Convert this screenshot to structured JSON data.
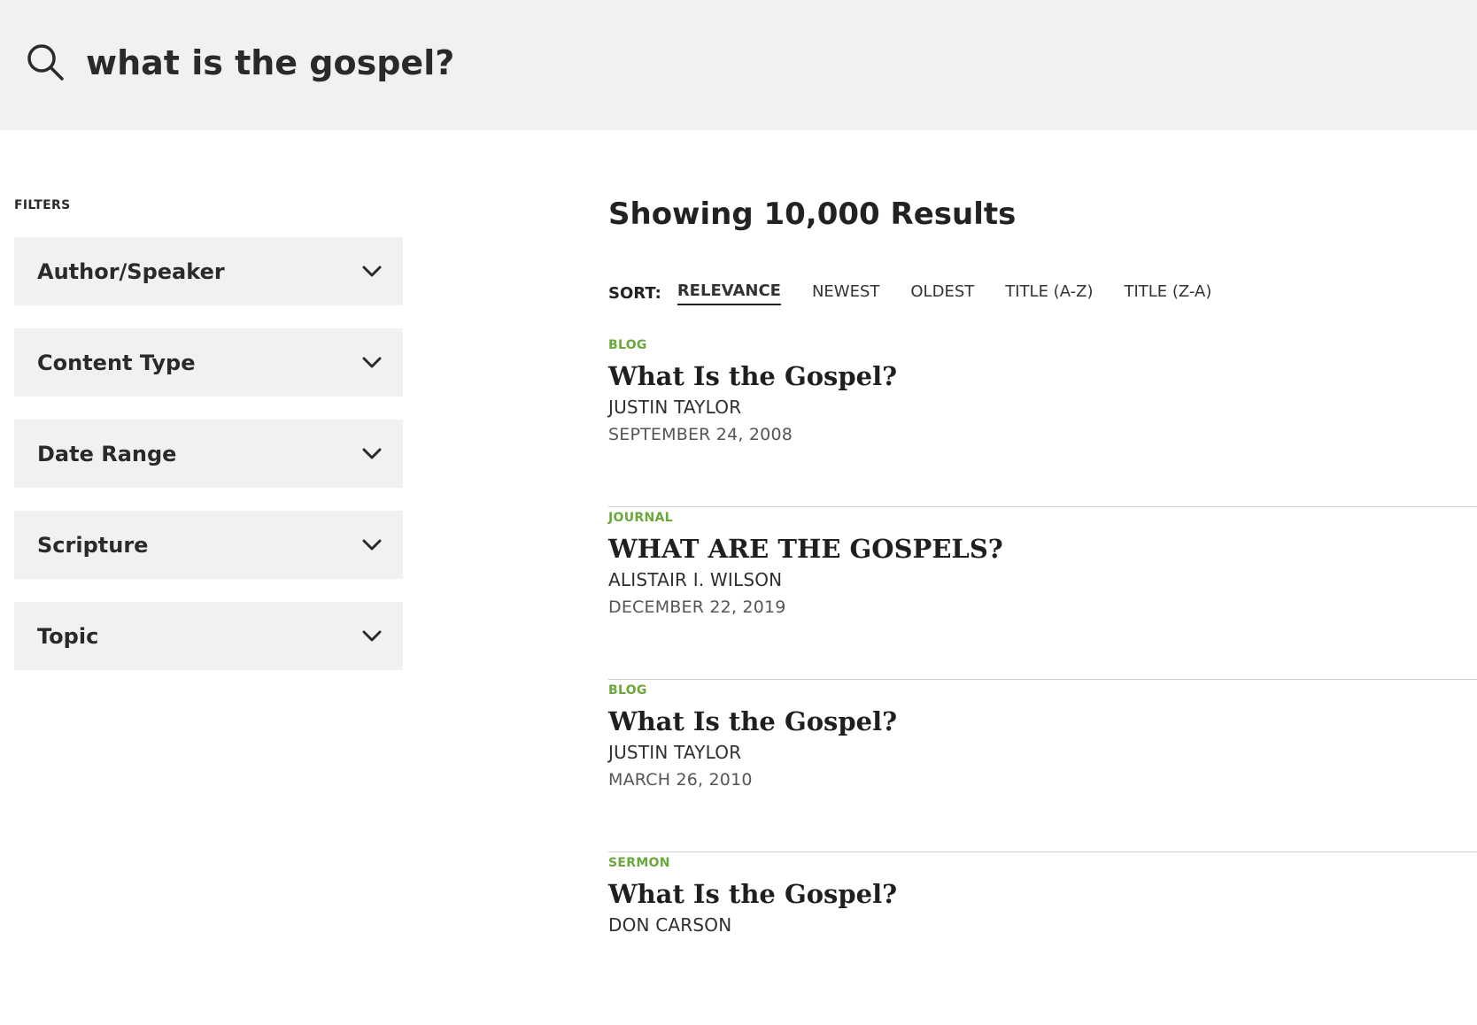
{
  "search": {
    "query": "what is the gospel?"
  },
  "filters": {
    "heading": "FILTERS",
    "items": [
      {
        "label": "Author/Speaker"
      },
      {
        "label": "Content Type"
      },
      {
        "label": "Date Range"
      },
      {
        "label": "Scripture"
      },
      {
        "label": "Topic"
      }
    ]
  },
  "results": {
    "heading": "Showing 10,000 Results",
    "sort": {
      "label": "SORT:",
      "options": [
        "RELEVANCE",
        "NEWEST",
        "OLDEST",
        "TITLE (A-Z)",
        "TITLE (Z-A)"
      ],
      "active": "RELEVANCE"
    },
    "items": [
      {
        "type": "BLOG",
        "title": "What Is the Gospel?",
        "author": "JUSTIN TAYLOR",
        "date": "SEPTEMBER 24, 2008"
      },
      {
        "type": "JOURNAL",
        "title": "WHAT ARE THE GOSPELS?",
        "author": "ALISTAIR I. WILSON",
        "date": "DECEMBER 22, 2019"
      },
      {
        "type": "BLOG",
        "title": "What Is the Gospel?",
        "author": "JUSTIN TAYLOR",
        "date": "MARCH 26, 2010"
      },
      {
        "type": "SERMON",
        "title": "What Is the Gospel?",
        "author": "DON CARSON",
        "date": ""
      }
    ]
  },
  "colors": {
    "accent_green": "#6aa83b",
    "panel_gray": "#f1f1f1",
    "text_dark": "#222222"
  },
  "icons": {
    "search": "search-icon",
    "chevron": "chevron-down-icon"
  }
}
